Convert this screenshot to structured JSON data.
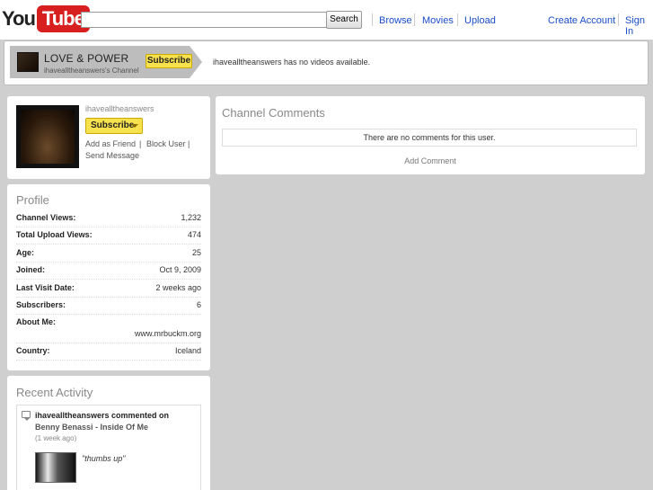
{
  "header": {
    "logo_you": "You",
    "logo_tube": "Tube",
    "search_button": "Search",
    "nav": [
      "Browse",
      "Movies",
      "Upload"
    ],
    "create_account": "Create Account",
    "sign_in": "Sign In"
  },
  "banner": {
    "title": "LOVE & POWER",
    "subtitle": "ihavealltheanswers's Channel",
    "subscribe": "Subscribe",
    "message": "ihavealltheanswers has no videos available."
  },
  "card": {
    "username": "ihavealltheanswers",
    "subscribe": "Subscribe",
    "add_friend": "Add as Friend",
    "sep1": "|",
    "block_user": "Block User",
    "sep2": "|",
    "send_message": "Send Message"
  },
  "profile": {
    "title": "Profile",
    "rows": [
      {
        "label": "Channel Views:",
        "value": "1,232"
      },
      {
        "label": "Total Upload Views:",
        "value": "474"
      },
      {
        "label": "Age:",
        "value": "25"
      },
      {
        "label": "Joined:",
        "value": "Oct 9, 2009"
      },
      {
        "label": "Last Visit Date:",
        "value": "2 weeks ago"
      },
      {
        "label": "Subscribers:",
        "value": "6"
      },
      {
        "label": "About Me:",
        "value": "www.mrbuckm.org"
      },
      {
        "label": "Country:",
        "value": "Iceland"
      }
    ]
  },
  "activity": {
    "title": "Recent Activity",
    "headline": "ihavealltheanswers commented on",
    "video": "Benny Benassi - Inside Of Me",
    "time": "(1 week ago)",
    "quote": "\"thumbs up\""
  },
  "comments": {
    "title": "Channel Comments",
    "empty": "There are no comments for this user.",
    "add": "Add Comment"
  }
}
